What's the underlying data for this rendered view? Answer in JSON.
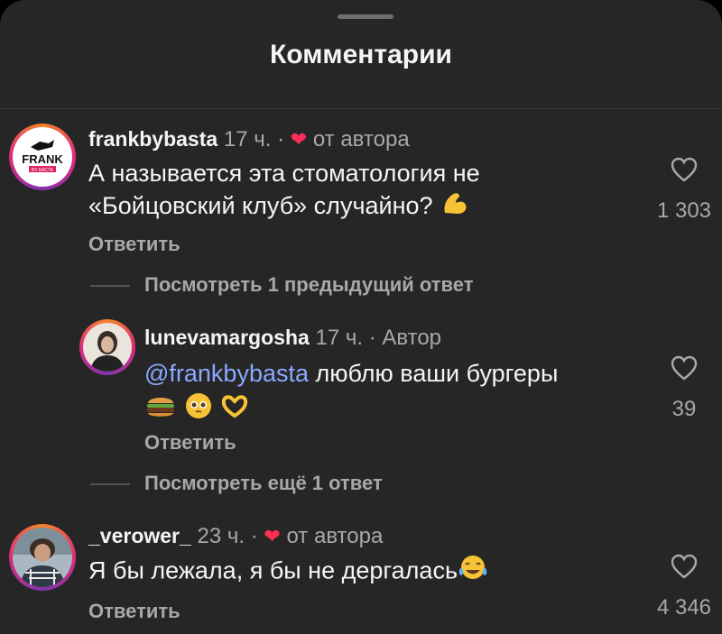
{
  "sheet": {
    "title": "Комментарии"
  },
  "comments": [
    {
      "username": "frankbybasta",
      "time": "17 ч.",
      "badge": "от автора",
      "line1": "А называется эта стоматология не",
      "line2": "«Бойцовский клуб» случайно?",
      "reply": "Ответить",
      "likes": "1 303",
      "avatar_text": "FRANK",
      "avatar_sub": "BY БАСТА"
    },
    {
      "username": "lunevamargosha",
      "time": "17 ч.",
      "badge": "Автор",
      "mention": "@frankbybasta",
      "text": "люблю ваши бургеры",
      "reply": "Ответить",
      "likes": "39"
    },
    {
      "username": "_verower_",
      "time": "23 ч.",
      "badge": "от автора",
      "text": "Я бы лежала, я бы не дергалась",
      "reply": "Ответить",
      "likes": "4 346"
    }
  ],
  "view_previous": "Посмотреть 1 предыдущий ответ",
  "view_more": "Посмотреть ещё 1 ответ",
  "separator_dot": "·",
  "colors": {
    "background": "#262626",
    "mention": "#8aa9ff",
    "heart": "#ff2d55",
    "muted": "#a8a8a8"
  }
}
